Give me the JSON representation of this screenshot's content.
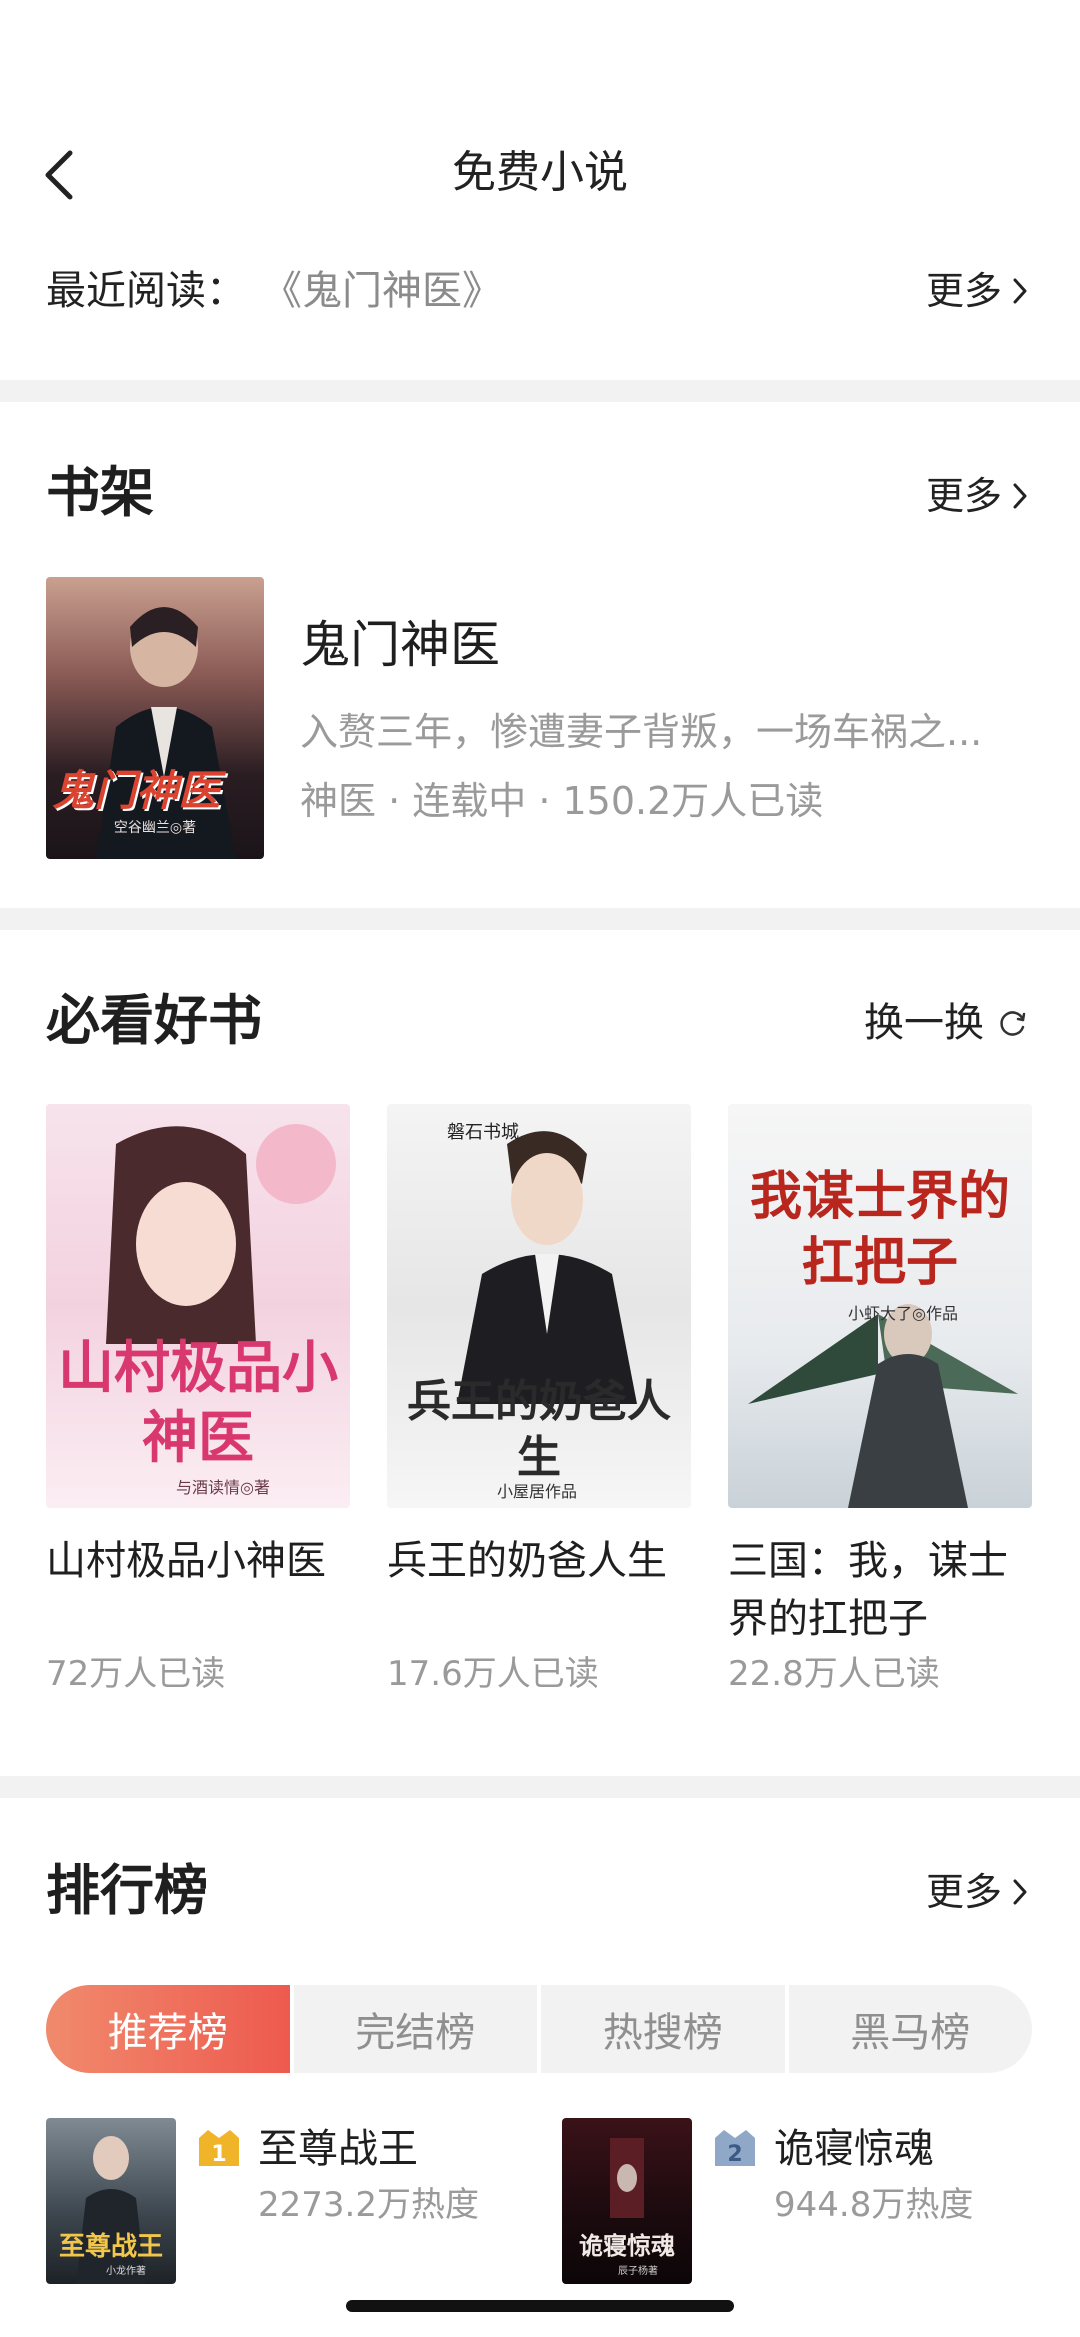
{
  "header": {
    "title": "免费小说"
  },
  "recent": {
    "label": "最近阅读：",
    "book": "《鬼门神医》",
    "more": "更多"
  },
  "shelf": {
    "title": "书架",
    "more": "更多",
    "book": {
      "title": "鬼门神医",
      "description": "入赘三年，惨遭妻子背叛，一场车祸之...",
      "meta": "神医 · 连载中 · 150.2万人已读",
      "cover_title": "鬼门神医",
      "cover_author": "空谷幽兰◎著"
    }
  },
  "must_read": {
    "title": "必看好书",
    "refresh": "换一换",
    "books": [
      {
        "title": "山村极品小神医",
        "reads": "72万人已读",
        "cover_title": "山村极品小神医",
        "cover_author": "与酒读情◎著"
      },
      {
        "title": "兵王的奶爸人生",
        "reads": "17.6万人已读",
        "cover_title": "兵王的奶爸人生",
        "cover_publisher": "磐石书城",
        "cover_author": "小屋居作品"
      },
      {
        "title": "三国：我，谋士界的扛把子",
        "reads": "22.8万人已读",
        "cover_title": "我谋士界的扛把子",
        "cover_author": "小虾大了◎作品"
      }
    ]
  },
  "ranking": {
    "title": "排行榜",
    "more": "更多",
    "tabs": [
      "推荐榜",
      "完结榜",
      "热搜榜",
      "黑马榜"
    ],
    "active_tab": "推荐榜",
    "items": [
      {
        "rank": "1",
        "title": "至尊战王",
        "heat": "2273.2万热度",
        "cover_title": "至尊战王",
        "cover_author": "小龙作著"
      },
      {
        "rank": "2",
        "title": "诡寝惊魂",
        "heat": "944.8万热度",
        "cover_title": "诡寝惊魂",
        "cover_author": "辰子杨著"
      }
    ]
  },
  "colors": {
    "accent": "#ee5a4e",
    "medal_gold": "#f0b429",
    "medal_silver": "#8fa8c8"
  }
}
